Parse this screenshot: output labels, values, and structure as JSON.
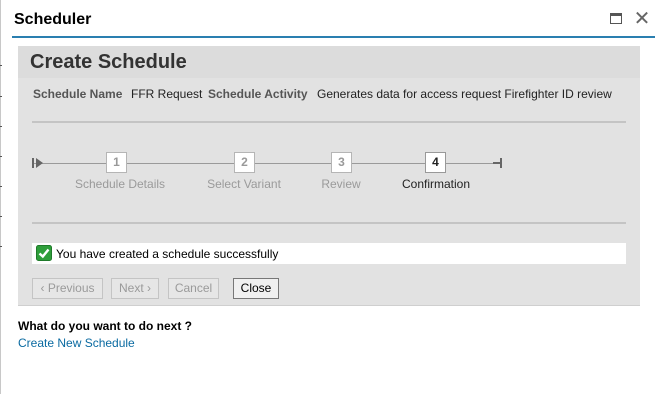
{
  "dialog": {
    "title": "Scheduler",
    "maximize_icon": "maximize-icon",
    "close_glyph": "✕"
  },
  "panel": {
    "title": "Create Schedule",
    "schedule_name_label": "Schedule Name",
    "schedule_name_value": "FFR Request",
    "schedule_activity_label": "Schedule Activity",
    "schedule_activity_value": "Generates data for access request Firefighter ID review"
  },
  "wizard": {
    "steps": [
      {
        "number": "1",
        "label": "Schedule Details",
        "active": false
      },
      {
        "number": "2",
        "label": "Select Variant",
        "active": false
      },
      {
        "number": "3",
        "label": "Review",
        "active": false
      },
      {
        "number": "4",
        "label": "Confirmation",
        "active": true
      }
    ]
  },
  "message": {
    "text": "You have created a schedule successfully",
    "icon": "checkmark-icon",
    "color": "#2e9e3a"
  },
  "buttons": {
    "previous": "Previous",
    "next": "Next",
    "cancel": "Cancel",
    "close": "Close"
  },
  "next_steps": {
    "heading": "What do you want to do next ?",
    "link": "Create New Schedule"
  },
  "colors": {
    "accent": "#2a7fb0",
    "link": "#0a6aa1"
  }
}
